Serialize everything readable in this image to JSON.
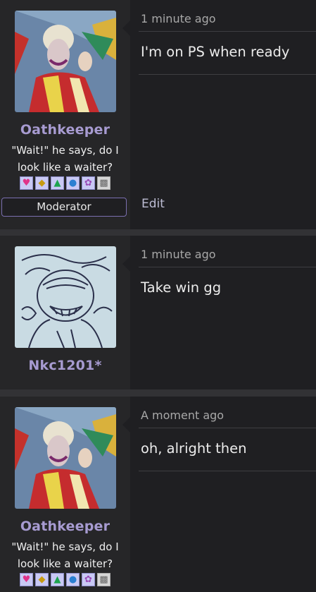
{
  "posts": [
    {
      "username": "Oathkeeper",
      "user_title": "\"Wait!\" he says, do I look like a waiter?",
      "badges": [
        "heart-badge-icon",
        "diamond-badge-icon",
        "leaf-badge-icon",
        "drop-badge-icon",
        "bow-badge-icon",
        "gray-badge-icon"
      ],
      "role": "Moderator",
      "timestamp": "1 minute ago",
      "message": "I'm on PS when ready",
      "edit_label": "Edit"
    },
    {
      "username": "Nkc1201*",
      "timestamp": "1 minute ago",
      "message": "Take win gg"
    },
    {
      "username": "Oathkeeper",
      "user_title": "\"Wait!\" he says, do I look like a waiter?",
      "badges": [
        "heart-badge-icon",
        "diamond-badge-icon",
        "leaf-badge-icon",
        "drop-badge-icon",
        "bow-badge-icon",
        "gray-badge-icon"
      ],
      "timestamp": "A moment ago",
      "message": "oh, alright then"
    }
  ],
  "colors": {
    "username": "#a79bd1",
    "role_border": "#7b6fb0",
    "panel": "#262628",
    "message_bg": "#1f1f22"
  }
}
